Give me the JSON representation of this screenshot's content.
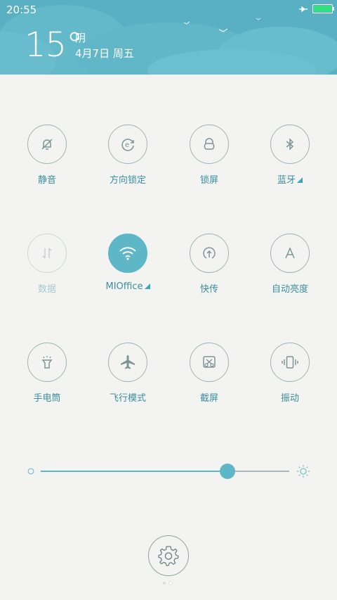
{
  "status_bar": {
    "time": "20:55",
    "battery_level": 1.0,
    "battery_color": "#2fe07c"
  },
  "weather": {
    "temperature": "15°",
    "condition": "阴",
    "date": "4月7日 周五"
  },
  "colors": {
    "accent": "#5db7c7",
    "header_bg": "#5ab0c3",
    "label": "#3a8e9d"
  },
  "toggles": [
    {
      "label": "静音",
      "icon": "bell-off-icon",
      "state": "off"
    },
    {
      "label": "方向锁定",
      "icon": "rotation-lock-icon",
      "state": "off"
    },
    {
      "label": "锁屏",
      "icon": "lock-icon",
      "state": "off"
    },
    {
      "label": "蓝牙",
      "icon": "bluetooth-icon",
      "state": "off",
      "has_menu": true
    },
    {
      "label": "数据",
      "icon": "mobile-data-icon",
      "state": "disabled"
    },
    {
      "label": "MIOffice",
      "icon": "wifi-icon",
      "state": "on",
      "has_menu": true
    },
    {
      "label": "快传",
      "icon": "quick-transfer-icon",
      "state": "off"
    },
    {
      "label": "自动亮度",
      "icon": "auto-brightness-icon",
      "state": "off"
    },
    {
      "label": "手电筒",
      "icon": "flashlight-icon",
      "state": "off"
    },
    {
      "label": "飞行模式",
      "icon": "airplane-icon",
      "state": "off"
    },
    {
      "label": "截屏",
      "icon": "screenshot-icon",
      "state": "off"
    },
    {
      "label": "振动",
      "icon": "vibrate-icon",
      "state": "off"
    }
  ],
  "brightness": {
    "level": 0.75
  },
  "pager": {
    "pages": 2,
    "current": 2
  }
}
